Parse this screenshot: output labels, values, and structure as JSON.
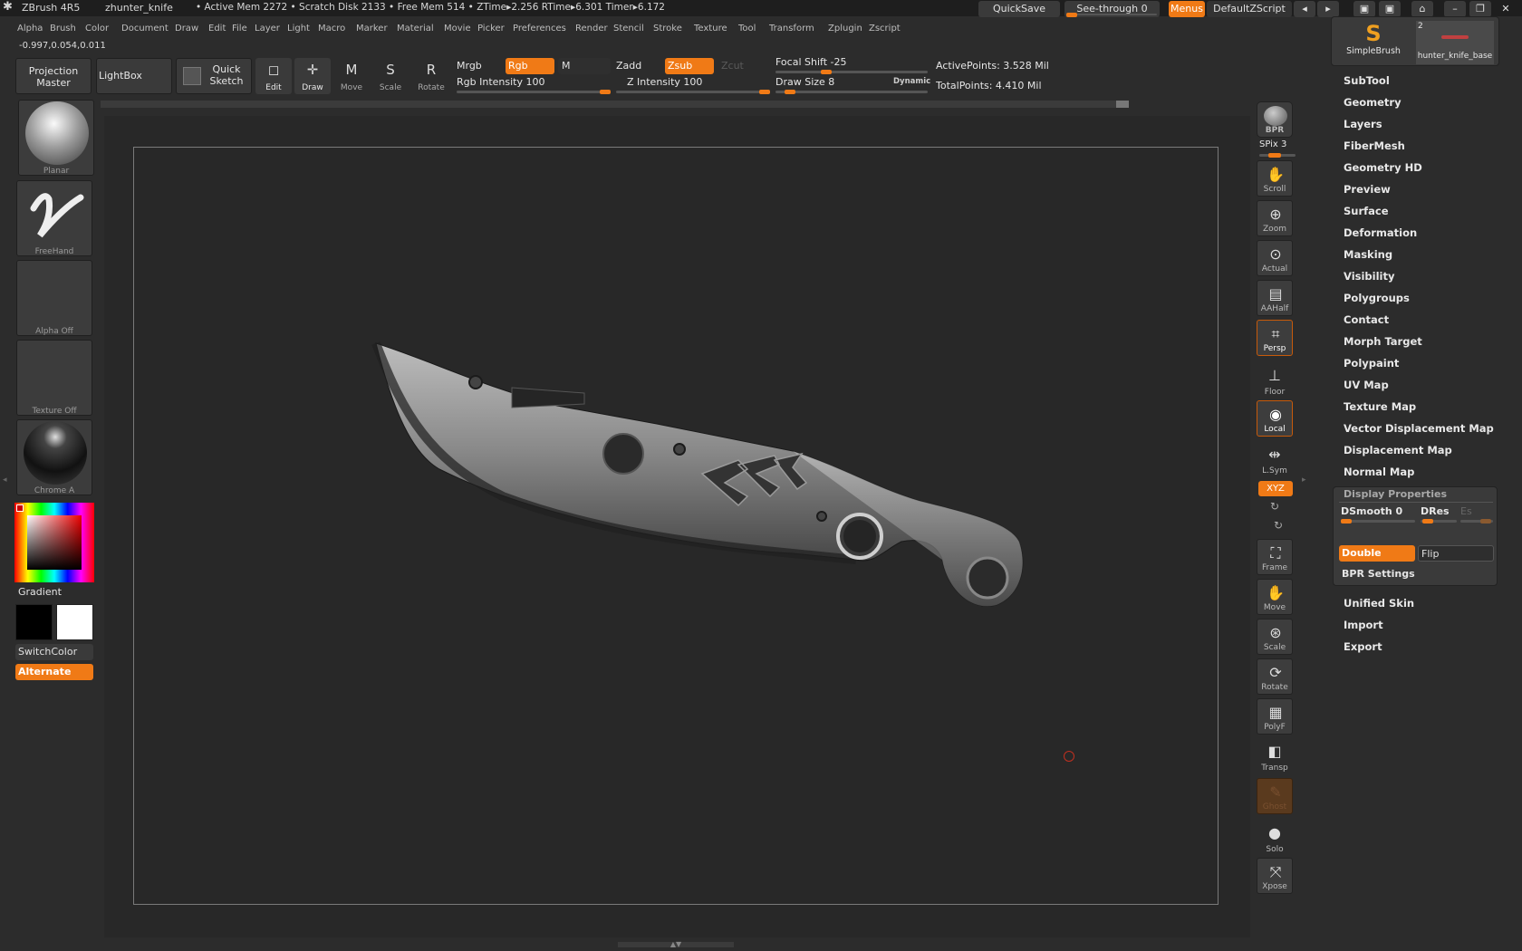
{
  "titlebar": {
    "app": "ZBrush 4R5",
    "doc": "zhunter_knife",
    "mem": "• Active Mem 2272 • Scratch Disk 2133 • Free Mem 514 • ZTime▸2.256 RTime▸6.301 Timer▸6.172",
    "quicksave": "QuickSave",
    "see_through": "See-through  0",
    "menus": "Menus",
    "default_script": "DefaultZScript"
  },
  "menubar": [
    "Alpha",
    "Brush",
    "Color",
    "Document",
    "Draw",
    "Edit",
    "File",
    "Layer",
    "Light",
    "Macro",
    "Marker",
    "Material",
    "Movie",
    "Picker",
    "Preferences",
    "Render",
    "Stencil",
    "Stroke",
    "Texture",
    "Tool",
    "Transform",
    "Zplugin",
    "Zscript"
  ],
  "coords": "-0.997,0.054,0.011",
  "toolbar": {
    "projection_master": "Projection Master",
    "lightbox": "LightBox",
    "quick_sketch": "Quick Sketch",
    "edit": "Edit",
    "draw": "Draw",
    "move": "Move",
    "scale": "Scale",
    "rotate": "Rotate",
    "mrgb": "Mrgb",
    "rgb": "Rgb",
    "m": "M",
    "zadd": "Zadd",
    "zsub": "Zsub",
    "zcut": "Zcut",
    "rgb_intensity": "Rgb Intensity 100",
    "z_intensity": "Z Intensity 100",
    "focal_shift": "Focal Shift -25",
    "draw_size": "Draw Size 8",
    "dynamic": "Dynamic",
    "active_points": "ActivePoints: 3.528 Mil",
    "total_points": "TotalPoints: 4.410 Mil"
  },
  "left": {
    "planar": "Planar",
    "freehand": "FreeHand",
    "alpha": "Alpha Off",
    "texture": "Texture Off",
    "material": "Chrome A",
    "gradient": "Gradient",
    "switch_color": "SwitchColor",
    "alternate": "Alternate"
  },
  "right_shelf": {
    "bpr": "BPR",
    "spix": "SPix 3",
    "scroll": "Scroll",
    "zoom": "Zoom",
    "actual": "Actual",
    "aahalf": "AAHalf",
    "persp": "Persp",
    "floor": "Floor",
    "local": "Local",
    "lsym": "L.Sym",
    "xyz": "XYZ",
    "frame": "Frame",
    "move": "Move",
    "scale": "Scale",
    "rotate": "Rotate",
    "polyf": "PolyF",
    "transp": "Transp",
    "ghost": "Ghost",
    "solo": "Solo",
    "xpose": "Xpose"
  },
  "tool_palette": {
    "simplebrush": "SimpleBrush",
    "hunter": "hunter_knife_base",
    "hunter_count": "2",
    "items": [
      "SubTool",
      "Geometry",
      "Layers",
      "FiberMesh",
      "Geometry HD",
      "Preview",
      "Surface",
      "Deformation",
      "Masking",
      "Visibility",
      "Polygroups",
      "Contact",
      "Morph Target",
      "Polypaint",
      "UV Map",
      "Texture Map",
      "Vector Displacement Map",
      "Displacement Map",
      "Normal Map"
    ],
    "display_properties": "Display Properties",
    "dsmooth": "DSmooth 0",
    "dres": "DRes",
    "es": "Es",
    "double": "Double",
    "flip": "Flip",
    "bpr_settings": "BPR Settings",
    "bottom_items": [
      "Unified Skin",
      "Import",
      "Export"
    ]
  },
  "colors": {
    "accent": "#f07a16",
    "bg": "#2c2c2c",
    "canvas": "#282828"
  }
}
